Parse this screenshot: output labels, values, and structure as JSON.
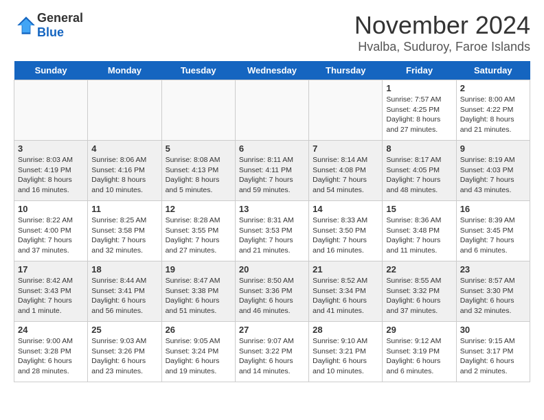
{
  "header": {
    "logo_general": "General",
    "logo_blue": "Blue",
    "month_title": "November 2024",
    "location": "Hvalba, Suduroy, Faroe Islands"
  },
  "weekdays": [
    "Sunday",
    "Monday",
    "Tuesday",
    "Wednesday",
    "Thursday",
    "Friday",
    "Saturday"
  ],
  "weeks": [
    [
      {
        "day": "",
        "info": ""
      },
      {
        "day": "",
        "info": ""
      },
      {
        "day": "",
        "info": ""
      },
      {
        "day": "",
        "info": ""
      },
      {
        "day": "",
        "info": ""
      },
      {
        "day": "1",
        "info": "Sunrise: 7:57 AM\nSunset: 4:25 PM\nDaylight: 8 hours\nand 27 minutes."
      },
      {
        "day": "2",
        "info": "Sunrise: 8:00 AM\nSunset: 4:22 PM\nDaylight: 8 hours\nand 21 minutes."
      }
    ],
    [
      {
        "day": "3",
        "info": "Sunrise: 8:03 AM\nSunset: 4:19 PM\nDaylight: 8 hours\nand 16 minutes."
      },
      {
        "day": "4",
        "info": "Sunrise: 8:06 AM\nSunset: 4:16 PM\nDaylight: 8 hours\nand 10 minutes."
      },
      {
        "day": "5",
        "info": "Sunrise: 8:08 AM\nSunset: 4:13 PM\nDaylight: 8 hours\nand 5 minutes."
      },
      {
        "day": "6",
        "info": "Sunrise: 8:11 AM\nSunset: 4:11 PM\nDaylight: 7 hours\nand 59 minutes."
      },
      {
        "day": "7",
        "info": "Sunrise: 8:14 AM\nSunset: 4:08 PM\nDaylight: 7 hours\nand 54 minutes."
      },
      {
        "day": "8",
        "info": "Sunrise: 8:17 AM\nSunset: 4:05 PM\nDaylight: 7 hours\nand 48 minutes."
      },
      {
        "day": "9",
        "info": "Sunrise: 8:19 AM\nSunset: 4:03 PM\nDaylight: 7 hours\nand 43 minutes."
      }
    ],
    [
      {
        "day": "10",
        "info": "Sunrise: 8:22 AM\nSunset: 4:00 PM\nDaylight: 7 hours\nand 37 minutes."
      },
      {
        "day": "11",
        "info": "Sunrise: 8:25 AM\nSunset: 3:58 PM\nDaylight: 7 hours\nand 32 minutes."
      },
      {
        "day": "12",
        "info": "Sunrise: 8:28 AM\nSunset: 3:55 PM\nDaylight: 7 hours\nand 27 minutes."
      },
      {
        "day": "13",
        "info": "Sunrise: 8:31 AM\nSunset: 3:53 PM\nDaylight: 7 hours\nand 21 minutes."
      },
      {
        "day": "14",
        "info": "Sunrise: 8:33 AM\nSunset: 3:50 PM\nDaylight: 7 hours\nand 16 minutes."
      },
      {
        "day": "15",
        "info": "Sunrise: 8:36 AM\nSunset: 3:48 PM\nDaylight: 7 hours\nand 11 minutes."
      },
      {
        "day": "16",
        "info": "Sunrise: 8:39 AM\nSunset: 3:45 PM\nDaylight: 7 hours\nand 6 minutes."
      }
    ],
    [
      {
        "day": "17",
        "info": "Sunrise: 8:42 AM\nSunset: 3:43 PM\nDaylight: 7 hours\nand 1 minute."
      },
      {
        "day": "18",
        "info": "Sunrise: 8:44 AM\nSunset: 3:41 PM\nDaylight: 6 hours\nand 56 minutes."
      },
      {
        "day": "19",
        "info": "Sunrise: 8:47 AM\nSunset: 3:38 PM\nDaylight: 6 hours\nand 51 minutes."
      },
      {
        "day": "20",
        "info": "Sunrise: 8:50 AM\nSunset: 3:36 PM\nDaylight: 6 hours\nand 46 minutes."
      },
      {
        "day": "21",
        "info": "Sunrise: 8:52 AM\nSunset: 3:34 PM\nDaylight: 6 hours\nand 41 minutes."
      },
      {
        "day": "22",
        "info": "Sunrise: 8:55 AM\nSunset: 3:32 PM\nDaylight: 6 hours\nand 37 minutes."
      },
      {
        "day": "23",
        "info": "Sunrise: 8:57 AM\nSunset: 3:30 PM\nDaylight: 6 hours\nand 32 minutes."
      }
    ],
    [
      {
        "day": "24",
        "info": "Sunrise: 9:00 AM\nSunset: 3:28 PM\nDaylight: 6 hours\nand 28 minutes."
      },
      {
        "day": "25",
        "info": "Sunrise: 9:03 AM\nSunset: 3:26 PM\nDaylight: 6 hours\nand 23 minutes."
      },
      {
        "day": "26",
        "info": "Sunrise: 9:05 AM\nSunset: 3:24 PM\nDaylight: 6 hours\nand 19 minutes."
      },
      {
        "day": "27",
        "info": "Sunrise: 9:07 AM\nSunset: 3:22 PM\nDaylight: 6 hours\nand 14 minutes."
      },
      {
        "day": "28",
        "info": "Sunrise: 9:10 AM\nSunset: 3:21 PM\nDaylight: 6 hours\nand 10 minutes."
      },
      {
        "day": "29",
        "info": "Sunrise: 9:12 AM\nSunset: 3:19 PM\nDaylight: 6 hours\nand 6 minutes."
      },
      {
        "day": "30",
        "info": "Sunrise: 9:15 AM\nSunset: 3:17 PM\nDaylight: 6 hours\nand 2 minutes."
      }
    ]
  ]
}
